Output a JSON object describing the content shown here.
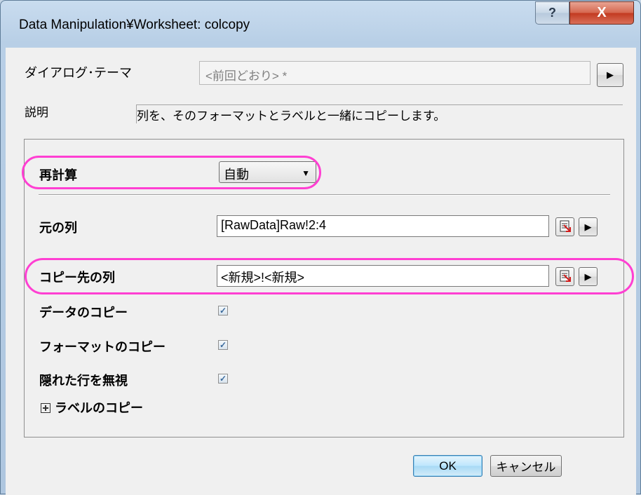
{
  "window": {
    "title": "Data Manipulation¥Worksheet: colcopy",
    "help_label": "?",
    "close_label": "X"
  },
  "theme": {
    "label": "ダイアログ･テーマ",
    "value": "<前回どおり> *",
    "arrow_icon": "triangle-right-icon"
  },
  "description": {
    "label": "説明",
    "text": "列を、そのフォーマットとラベルと一緒にコピーします。"
  },
  "recalculate": {
    "label": "再計算",
    "selected": "自動"
  },
  "source_columns": {
    "label": "元の列",
    "value": "[RawData]Raw!2:4"
  },
  "destination_columns": {
    "label": "コピー先の列",
    "value": "<新規>!<新規>"
  },
  "options": [
    {
      "label": "データのコピー",
      "checked": true
    },
    {
      "label": "フォーマットのコピー",
      "checked": true
    },
    {
      "label": "隠れた行を無視",
      "checked": true
    }
  ],
  "label_copy": {
    "label": "ラベルのコピー",
    "expanded": false
  },
  "buttons": {
    "ok": "OK",
    "cancel": "キャンセル"
  },
  "colors": {
    "highlight": "#ff3fd2",
    "ok_button": "#bee6fd",
    "close_button": "#c2391f"
  }
}
